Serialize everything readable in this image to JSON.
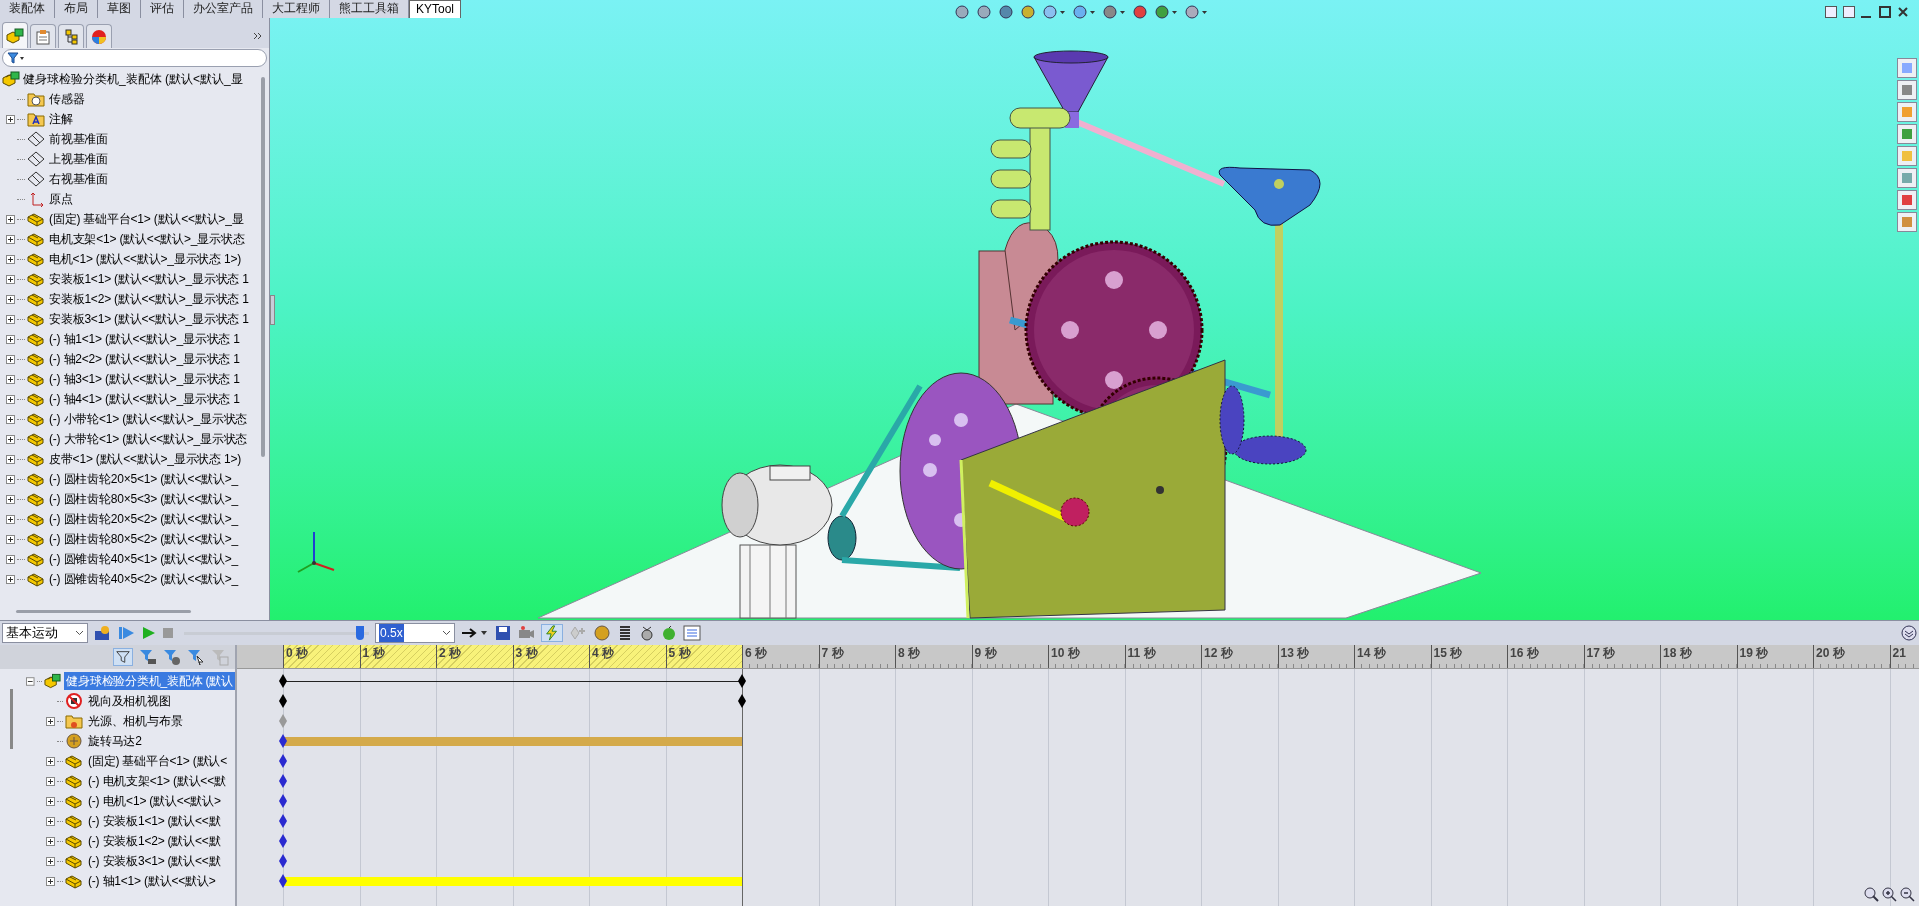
{
  "command_tabs": [
    {
      "label": "装配体",
      "selected": false
    },
    {
      "label": "布局",
      "selected": false
    },
    {
      "label": "草图",
      "selected": false
    },
    {
      "label": "评估",
      "selected": false
    },
    {
      "label": "办公室产品",
      "selected": false
    },
    {
      "label": "大工程师",
      "selected": false
    },
    {
      "label": "熊工工具箱",
      "selected": false
    },
    {
      "label": "KYTool",
      "selected": true
    }
  ],
  "feature_tree": {
    "root": {
      "label": "健身球检验分类机_装配体  (默认<默认_显",
      "kind": "assembly"
    },
    "items": [
      {
        "label": "传感器",
        "kind": "sensor-folder",
        "expandable": false
      },
      {
        "label": "注解",
        "kind": "annotation-folder",
        "expandable": true
      },
      {
        "label": "前视基准面",
        "kind": "plane",
        "expandable": false
      },
      {
        "label": "上视基准面",
        "kind": "plane",
        "expandable": false
      },
      {
        "label": "右视基准面",
        "kind": "plane",
        "expandable": false
      },
      {
        "label": "原点",
        "kind": "origin",
        "expandable": false
      },
      {
        "label": "(固定) 基础平台<1> (默认<<默认>_显",
        "kind": "part",
        "expandable": true
      },
      {
        "label": "电机支架<1> (默认<<默认>_显示状态",
        "kind": "part",
        "expandable": true
      },
      {
        "label": "电机<1> (默认<<默认>_显示状态 1>)",
        "kind": "part",
        "expandable": true
      },
      {
        "label": "安装板1<1> (默认<<默认>_显示状态 1",
        "kind": "part",
        "expandable": true
      },
      {
        "label": "安装板1<2> (默认<<默认>_显示状态 1",
        "kind": "part",
        "expandable": true
      },
      {
        "label": "安装板3<1> (默认<<默认>_显示状态 1",
        "kind": "part",
        "expandable": true
      },
      {
        "label": "(-) 轴1<1> (默认<<默认>_显示状态 1",
        "kind": "part",
        "expandable": true
      },
      {
        "label": "(-) 轴2<2> (默认<<默认>_显示状态 1",
        "kind": "part",
        "expandable": true
      },
      {
        "label": "(-) 轴3<1> (默认<<默认>_显示状态 1",
        "kind": "part",
        "expandable": true
      },
      {
        "label": "(-) 轴4<1> (默认<<默认>_显示状态 1",
        "kind": "part",
        "expandable": true
      },
      {
        "label": "(-) 小带轮<1> (默认<<默认>_显示状态",
        "kind": "part",
        "expandable": true
      },
      {
        "label": "(-) 大带轮<1> (默认<<默认>_显示状态",
        "kind": "part",
        "expandable": true
      },
      {
        "label": "皮带<1> (默认<<默认>_显示状态 1>)",
        "kind": "part",
        "expandable": true
      },
      {
        "label": "(-) 圆柱齿轮20×5<1> (默认<<默认>_",
        "kind": "part",
        "expandable": true
      },
      {
        "label": "(-) 圆柱齿轮80×5<3> (默认<<默认>_",
        "kind": "part",
        "expandable": true
      },
      {
        "label": "(-) 圆柱齿轮20×5<2> (默认<<默认>_",
        "kind": "part",
        "expandable": true
      },
      {
        "label": "(-) 圆柱齿轮80×5<2> (默认<<默认>_",
        "kind": "part",
        "expandable": true
      },
      {
        "label": "(-) 圆锥齿轮40×5<1> (默认<<默认>_",
        "kind": "part",
        "expandable": true
      },
      {
        "label": "(-) 圆锥齿轮40×5<2> (默认<<默认>_",
        "kind": "part",
        "expandable": true
      }
    ]
  },
  "motion_study": {
    "study_type": "基本运动",
    "time_slider": {
      "level": 0.97
    },
    "speed": "0.5x",
    "ticks": [
      {
        "label": "0 秒",
        "hatched": true
      },
      {
        "label": "1 秒",
        "hatched": true
      },
      {
        "label": "2 秒",
        "hatched": true
      },
      {
        "label": "3 秒",
        "hatched": true
      },
      {
        "label": "4 秒",
        "hatched": true
      },
      {
        "label": "5 秒",
        "hatched": true
      },
      {
        "label": "6 秒",
        "hatched": false
      },
      {
        "label": "7 秒",
        "hatched": false
      },
      {
        "label": "8 秒",
        "hatched": false
      },
      {
        "label": "9 秒",
        "hatched": false
      },
      {
        "label": "10 秒",
        "hatched": false
      },
      {
        "label": "11 秒",
        "hatched": false
      },
      {
        "label": "12 秒",
        "hatched": false
      },
      {
        "label": "13 秒",
        "hatched": false
      },
      {
        "label": "14 秒",
        "hatched": false
      },
      {
        "label": "15 秒",
        "hatched": false
      },
      {
        "label": "16 秒",
        "hatched": false
      },
      {
        "label": "17 秒",
        "hatched": false
      },
      {
        "label": "18 秒",
        "hatched": false
      },
      {
        "label": "19 秒",
        "hatched": false
      },
      {
        "label": "20 秒",
        "hatched": false
      },
      {
        "label": "21",
        "hatched": false
      }
    ],
    "rows": [
      {
        "label": "健身球检验分类机_装配体  (默认",
        "kind": "assembly",
        "expandable": true,
        "expanded": true,
        "selected": true,
        "track": {
          "kind": "keys-line"
        }
      },
      {
        "label": "视向及相机视图",
        "kind": "camera",
        "expandable": false,
        "expanded": false,
        "selected": false,
        "track": {
          "kind": "keys"
        }
      },
      {
        "label": "光源、相机与布景",
        "kind": "lights",
        "expandable": true,
        "expanded": false,
        "selected": false,
        "track": {
          "kind": "gray-key"
        }
      },
      {
        "label": "旋转马达2",
        "kind": "motor",
        "expandable": false,
        "expanded": false,
        "selected": false,
        "track": {
          "kind": "bar",
          "color": "#d4aa4a"
        }
      },
      {
        "label": "(固定) 基础平台<1> (默认<",
        "kind": "part",
        "expandable": true,
        "expanded": false,
        "selected": false,
        "track": {
          "kind": "key"
        }
      },
      {
        "label": "(-) 电机支架<1> (默认<<默",
        "kind": "part",
        "expandable": true,
        "expanded": false,
        "selected": false,
        "track": {
          "kind": "key"
        }
      },
      {
        "label": "(-) 电机<1> (默认<<默认>",
        "kind": "part",
        "expandable": true,
        "expanded": false,
        "selected": false,
        "track": {
          "kind": "key"
        }
      },
      {
        "label": "(-) 安装板1<1> (默认<<默",
        "kind": "part",
        "expandable": true,
        "expanded": false,
        "selected": false,
        "track": {
          "kind": "key"
        }
      },
      {
        "label": "(-) 安装板1<2> (默认<<默",
        "kind": "part",
        "expandable": true,
        "expanded": false,
        "selected": false,
        "track": {
          "kind": "key"
        }
      },
      {
        "label": "(-) 安装板3<1> (默认<<默",
        "kind": "part",
        "expandable": true,
        "expanded": false,
        "selected": false,
        "track": {
          "kind": "key"
        }
      },
      {
        "label": "(-) 轴1<1> (默认<<默认>",
        "kind": "part",
        "expandable": true,
        "expanded": false,
        "selected": false,
        "track": {
          "kind": "bar",
          "color": "#ffff00"
        }
      }
    ]
  }
}
